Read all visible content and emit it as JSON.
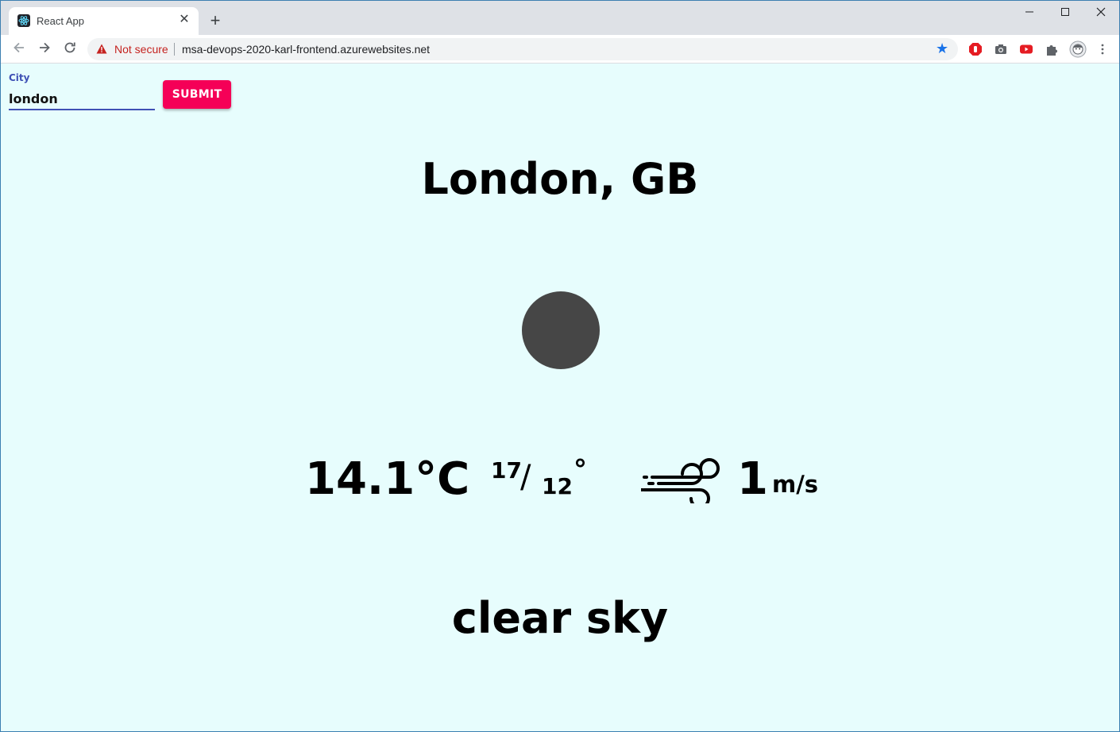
{
  "browser": {
    "tab_title": "React App",
    "security_label": "Not secure",
    "url": "msa-devops-2020-karl-frontend.azurewebsites.net"
  },
  "form": {
    "city_label": "City",
    "city_value": "london",
    "submit_label": "SUBMIT"
  },
  "weather": {
    "location": "London, GB",
    "temperature": "14.1°C",
    "high": "17",
    "low": "12",
    "degree_symbol": "°",
    "wind_speed": "1",
    "wind_unit": "m/s",
    "description": "clear sky",
    "icon": "weather-circle",
    "icon_color": "#464646"
  },
  "colors": {
    "page_background": "#e7fdfd",
    "submit_button": "#f50057",
    "input_accent": "#3f51b5",
    "not_secure": "#c5221f"
  }
}
